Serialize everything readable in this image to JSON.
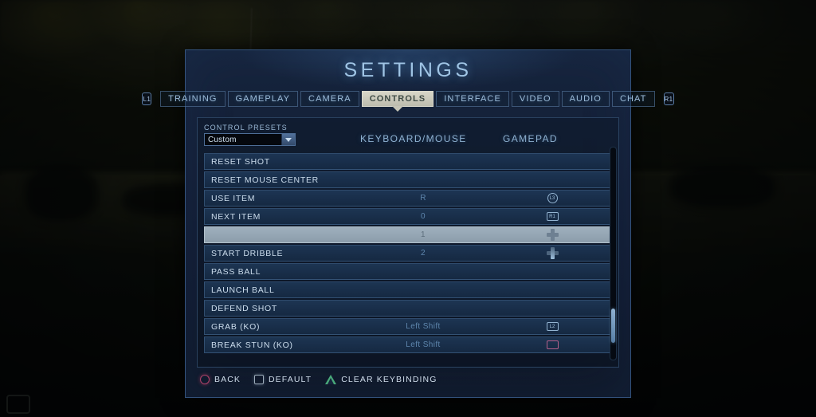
{
  "window": {
    "title": "SETTINGS"
  },
  "nav": {
    "left_bumper": "L1",
    "right_bumper": "R1",
    "tabs": [
      {
        "label": "TRAINING",
        "active": false
      },
      {
        "label": "GAMEPLAY",
        "active": false
      },
      {
        "label": "CAMERA",
        "active": false
      },
      {
        "label": "CONTROLS",
        "active": true
      },
      {
        "label": "INTERFACE",
        "active": false
      },
      {
        "label": "VIDEO",
        "active": false
      },
      {
        "label": "AUDIO",
        "active": false
      },
      {
        "label": "CHAT",
        "active": false
      }
    ]
  },
  "presets": {
    "label": "CONTROL PRESETS",
    "value": "Custom",
    "options": [
      "Custom"
    ]
  },
  "columns": {
    "keyboard_mouse": "KEYBOARD/MOUSE",
    "gamepad": "GAMEPAD"
  },
  "bindings": [
    {
      "action": "RESET SHOT",
      "keyboard": "",
      "gamepad": "",
      "selected": false
    },
    {
      "action": "RESET MOUSE CENTER",
      "keyboard": "",
      "gamepad": "",
      "selected": false
    },
    {
      "action": "USE ITEM",
      "keyboard": "R",
      "gamepad": "L3",
      "selected": false
    },
    {
      "action": "NEXT ITEM",
      "keyboard": "0",
      "gamepad": "R1",
      "selected": false
    },
    {
      "action": "",
      "keyboard": "1",
      "gamepad": "dpad",
      "selected": true
    },
    {
      "action": "START DRIBBLE",
      "keyboard": "2",
      "gamepad": "dpad-down",
      "selected": false
    },
    {
      "action": "PASS BALL",
      "keyboard": "",
      "gamepad": "",
      "selected": false
    },
    {
      "action": "LAUNCH BALL",
      "keyboard": "",
      "gamepad": "",
      "selected": false
    },
    {
      "action": "DEFEND SHOT",
      "keyboard": "",
      "gamepad": "",
      "selected": false
    },
    {
      "action": "GRAB (KO)",
      "keyboard": "Left Shift",
      "gamepad": "L2",
      "selected": false
    },
    {
      "action": "BREAK STUN (KO)",
      "keyboard": "Left Shift",
      "gamepad": "square",
      "selected": false
    }
  ],
  "scroll": {
    "thumb_top_pct": 76,
    "thumb_height_pct": 16
  },
  "footer": {
    "hints": [
      {
        "glyph": "circle",
        "label": "BACK"
      },
      {
        "glyph": "square",
        "label": "DEFAULT"
      },
      {
        "glyph": "triangle",
        "label": "CLEAR KEYBINDING"
      }
    ]
  },
  "hud": {
    "corner_text": ""
  },
  "colors": {
    "panel_border": "#33527c",
    "title": "#9fc4e4",
    "row_bg": "#1e3756",
    "row_selected": "#9fb0bd",
    "accent_back": "#b0436a",
    "accent_clear": "#49a97a",
    "accent_pink": "#c97aa2"
  }
}
